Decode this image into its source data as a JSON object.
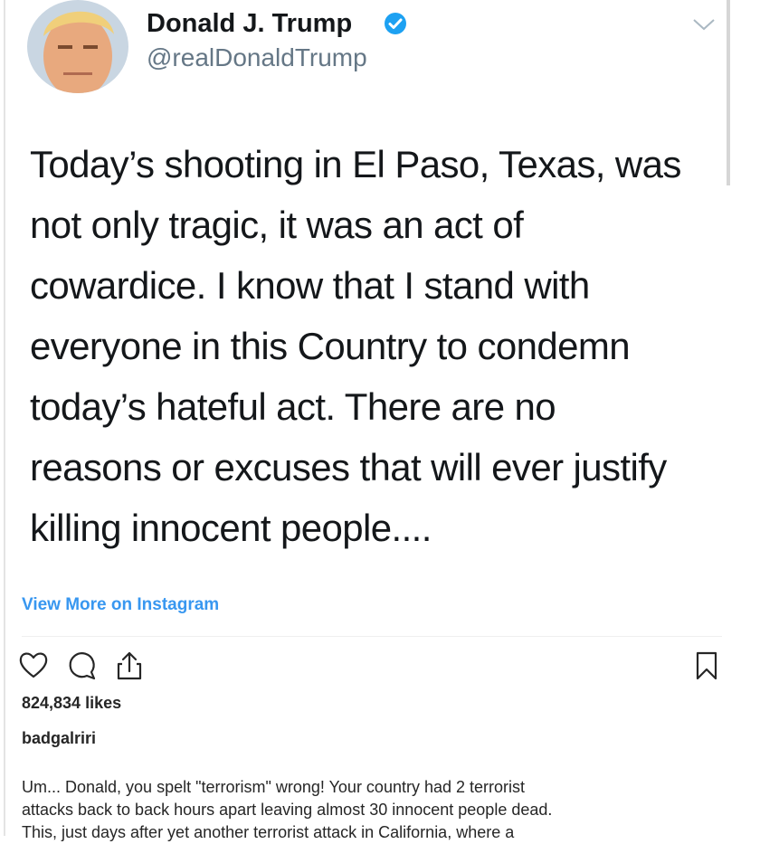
{
  "tweet": {
    "author_name": "Donald J. Trump",
    "handle": "@realDonaldTrump",
    "lines": [
      "Today’s shooting in El Paso, Texas, was",
      "not only tragic, it was an act of",
      "cowardice. I know that I stand with",
      "everyone in this Country to condemn",
      "today’s hateful act. There are no",
      "reasons or excuses that will ever justify",
      "killing innocent people...."
    ]
  },
  "instagram": {
    "view_more": "View More on Instagram",
    "likes": "824,834 likes",
    "username": "badgalriri",
    "caption_lines": [
      "Um... Donald, you spelt \"terrorism\" wrong! Your country had 2 terrorist",
      "attacks back to back hours apart leaving almost 30 innocent people dead.",
      "This, just days after yet another terrorist attack in California, where a"
    ]
  },
  "colors": {
    "verified": "#1da1f2",
    "link": "#3897f0",
    "handle": "#657786"
  },
  "icons": [
    "verified-badge-icon",
    "chevron-down-icon",
    "heart-icon",
    "comment-icon",
    "share-icon",
    "bookmark-icon"
  ]
}
